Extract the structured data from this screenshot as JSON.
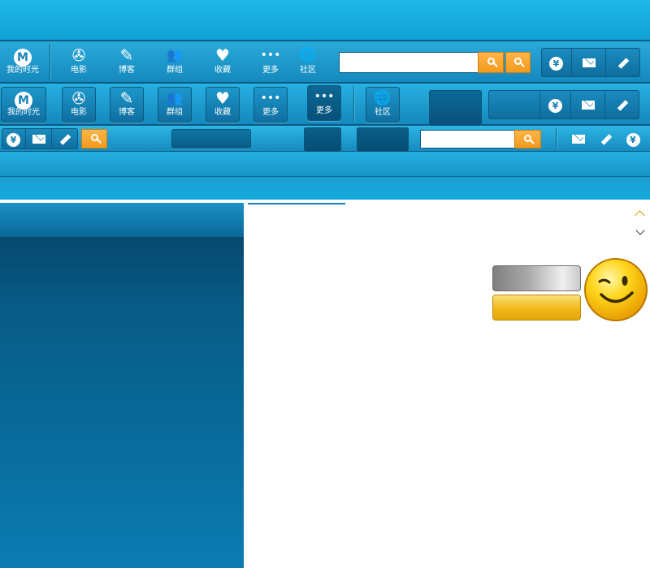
{
  "colors": {
    "primary_blue": "#1589bd",
    "dark_blue": "#07507a",
    "accent_orange": "#f39a1c",
    "sidebar_blue": "#0b6c9d"
  },
  "nav_row1": [
    {
      "label": "我的时光",
      "icon": "logo-icon"
    },
    {
      "label": "电影",
      "icon": "film-reel-icon"
    },
    {
      "label": "博客",
      "icon": "blog-pen-icon"
    },
    {
      "label": "群组",
      "icon": "group-icon"
    },
    {
      "label": "收藏",
      "icon": "heart-icon"
    },
    {
      "label": "更多",
      "icon": "more-dots-icon"
    },
    {
      "label": "社区",
      "icon": "globe-icon"
    }
  ],
  "nav_row2": [
    {
      "label": "我的时光",
      "icon": "logo-icon"
    },
    {
      "label": "电影",
      "icon": "film-reel-icon"
    },
    {
      "label": "博客",
      "icon": "blog-pen-icon"
    },
    {
      "label": "群组",
      "icon": "group-icon"
    },
    {
      "label": "收藏",
      "icon": "heart-icon"
    },
    {
      "label": "更多",
      "icon": "more-dots-icon"
    },
    {
      "label": "更多",
      "icon": "more-dots-icon"
    },
    {
      "label": "社区",
      "icon": "globe-icon"
    }
  ],
  "search": {
    "value_row1": "",
    "value_row3": ""
  },
  "icons": {
    "logo_letter": "M",
    "currency_symbol": "¥",
    "film": "✇",
    "pen": "✎",
    "group": "👥",
    "heart": "♥",
    "dots": "•••",
    "globe": "🌐"
  }
}
